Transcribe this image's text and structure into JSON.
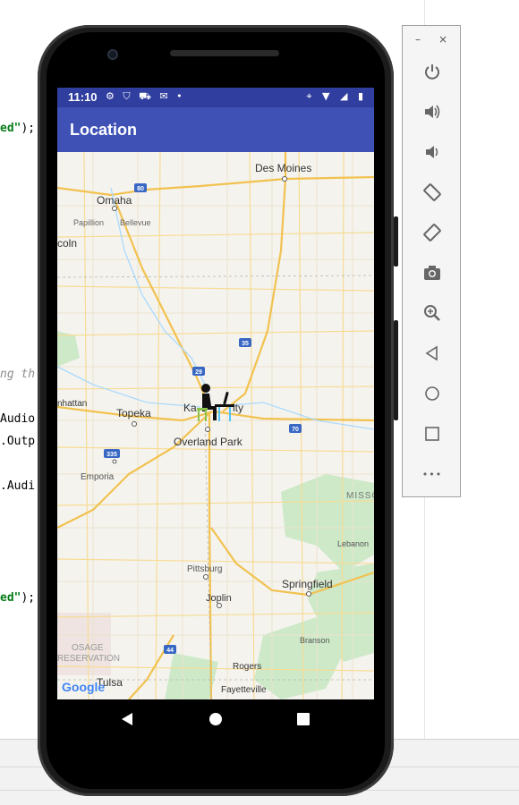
{
  "code": {
    "lines": [
      {
        "pre": "",
        "str": "ed\"",
        "post": ");"
      },
      {
        "text": "ng th"
      },
      {
        "text": "Audio"
      },
      {
        "text": ".Outp"
      },
      {
        "text": ".Audi"
      },
      {
        "pre": "",
        "str": "ed\"",
        "post": ");"
      }
    ]
  },
  "status_bar": {
    "time": "11:10",
    "icons": "⚙ ⛉ ⛟ ✉ •",
    "right_icons": "⌖ ▼ ◢ ▮"
  },
  "app_bar": {
    "title": "Location"
  },
  "map": {
    "cities": {
      "des_moines": "Des Moines",
      "omaha": "Omaha",
      "papillion": "Papillion",
      "bellevue": "Bellevue",
      "lincoln": "coln",
      "manhattan": "nhattan",
      "topeka": "Topeka",
      "kansas_city": "Ka",
      "kansas_city_end": "ity",
      "overland_park": "Overland Park",
      "emporia": "Emporia",
      "pittsburg": "Pittsburg",
      "joplin": "Joplin",
      "springfield": "Springfield",
      "lebanon": "Lebanon",
      "missouri": "MISSO",
      "branson": "Branson",
      "rogers": "Rogers",
      "fayetteville": "Fayetteville",
      "tulsa": "Tulsa",
      "osage1": "OSAGE",
      "osage2": "RESERVATION"
    },
    "highways": {
      "i80": "80",
      "i29": "29",
      "i35": "35",
      "i70": "70",
      "i335": "335",
      "i44": "44"
    },
    "logo": "Google"
  },
  "emulator_controls": {
    "minimize": "–",
    "close": "×",
    "more": "•••"
  },
  "colors": {
    "status_bar": "#303f9f",
    "app_bar": "#3f51b5",
    "map_bg": "#f5f3ee",
    "road": "#f7d67a",
    "water": "#aadaff",
    "park": "#cde9c8"
  }
}
